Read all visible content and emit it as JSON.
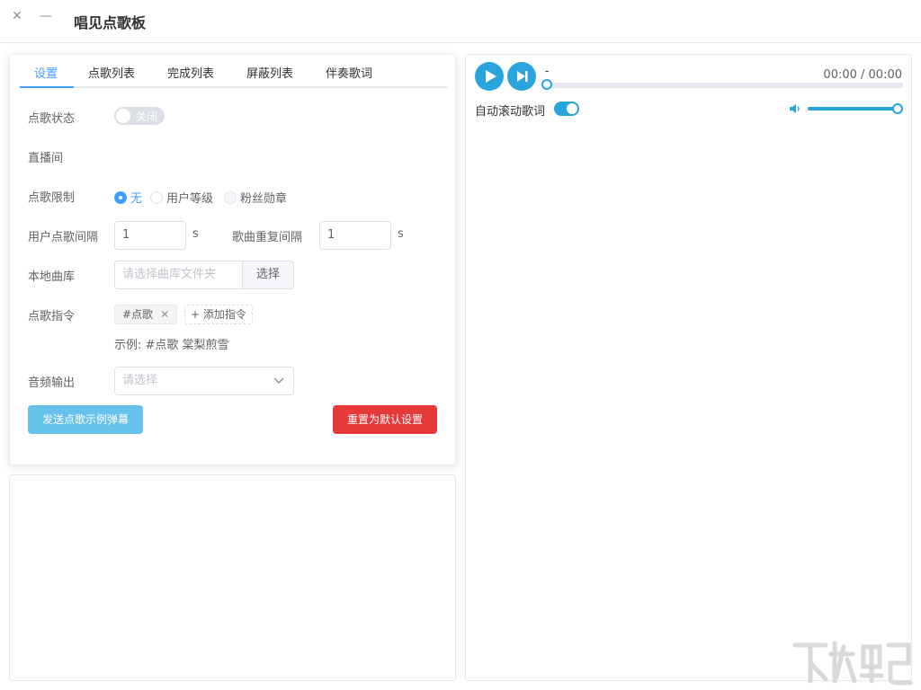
{
  "window": {
    "title": "唱见点歌板",
    "close_glyph": "✕",
    "minimize_glyph": "—"
  },
  "tabs": [
    {
      "label": "设置",
      "active": true
    },
    {
      "label": "点歌列表",
      "active": false
    },
    {
      "label": "完成列表",
      "active": false
    },
    {
      "label": "屏蔽列表",
      "active": false
    },
    {
      "label": "伴奏歌词",
      "active": false
    }
  ],
  "settings": {
    "status": {
      "label": "点歌状态",
      "switch_text": "关闭",
      "on": false
    },
    "live_room": {
      "label": "直播间"
    },
    "limit": {
      "label": "点歌限制",
      "options": [
        {
          "label": "无",
          "checked": true
        },
        {
          "label": "用户等级",
          "checked": false
        },
        {
          "label": "粉丝勋章",
          "checked": false
        }
      ]
    },
    "user_interval": {
      "label": "用户点歌间隔",
      "value": "1",
      "unit": "s"
    },
    "repeat_interval": {
      "label": "歌曲重复间隔",
      "value": "1",
      "unit": "s"
    },
    "library": {
      "label": "本地曲库",
      "placeholder": "请选择曲库文件夹",
      "button": "选择"
    },
    "command": {
      "label": "点歌指令",
      "tag": "#点歌",
      "add_label": "添加指令",
      "example": "示例: #点歌 棠梨煎雪"
    },
    "audio_output": {
      "label": "音频输出",
      "placeholder": "请选择"
    },
    "send_button": "发送点歌示例弹幕",
    "reset_button": "重置为默认设置"
  },
  "player": {
    "song_title": "-",
    "time": "00:00 / 00:00",
    "progress": 0,
    "auto_scroll_label": "自动滚动歌词",
    "auto_scroll_on": true,
    "volume": 1.0
  },
  "colors": {
    "accent": "#409eff",
    "player_accent": "#29a4dd",
    "send_button": "#66c2ea",
    "reset_button": "#e63a3a"
  }
}
